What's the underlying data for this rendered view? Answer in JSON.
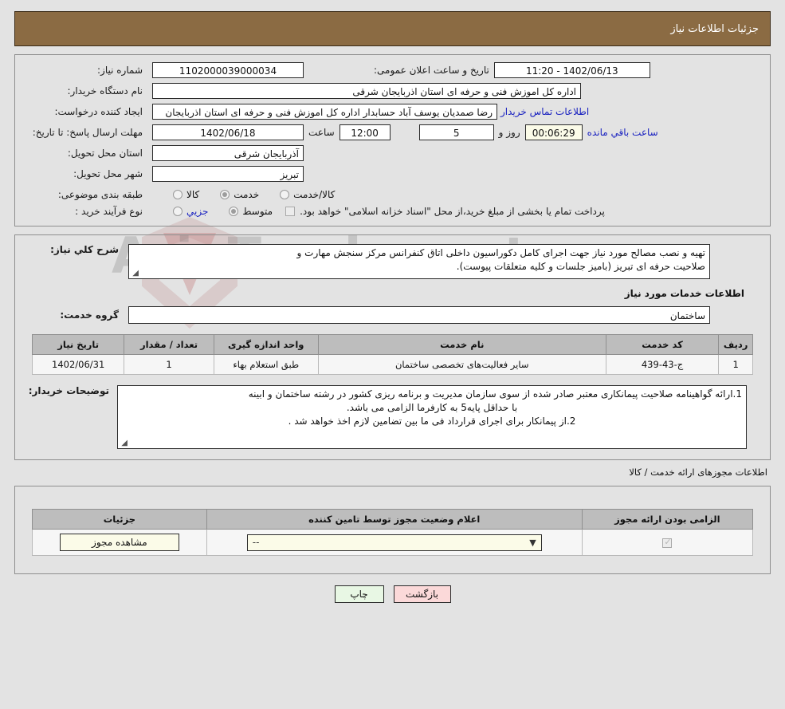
{
  "header": {
    "title": "جزئیات اطلاعات نیاز"
  },
  "form": {
    "need_number_label": "شماره نیاز:",
    "need_number_value": "1102000039000034",
    "announce_label": "تاریخ و ساعت اعلان عمومی:",
    "announce_value": "1402/06/13 - 11:20",
    "buyer_org_label": "نام دستگاه خریدار:",
    "buyer_org_value": "اداره کل اموزش فنی و حرفه ای استان اذربایجان شرقی",
    "creator_label": "ایجاد کننده درخواست:",
    "creator_value": "رضا صمدیان یوسف آباد حسابدار اداره کل اموزش فنی و حرفه ای استان اذربایجان",
    "contact_link": "اطلاعات تماس خریدار",
    "deadline_label": "مهلت ارسال پاسخ: تا تاریخ:",
    "deadline_date": "1402/06/18",
    "hour_label": "ساعت",
    "deadline_time": "12:00",
    "days_left": "5",
    "days_label": "روز و",
    "countdown": "00:06:29",
    "remaining_label": "ساعت باقي مانده",
    "province_label": "استان محل تحویل:",
    "province_value": "آذربایجان شرقی",
    "city_label": "شهر محل تحویل:",
    "city_value": "تبریز",
    "category_label": "طبقه بندی موضوعی:",
    "category_options": [
      {
        "label": "کالا",
        "selected": false
      },
      {
        "label": "خدمت",
        "selected": true
      },
      {
        "label": "کالا/خدمت",
        "selected": false
      }
    ],
    "process_label": "نوع فرآیند خرید :",
    "process_options": [
      {
        "label": "جزیي",
        "selected": false
      },
      {
        "label": "متوسط",
        "selected": true
      }
    ],
    "treasury_checkbox_checked": false,
    "treasury_note": "پرداخت تمام یا بخشی از مبلغ خرید،از محل \"اسناد خزانه اسلامی\" خواهد بود."
  },
  "description": {
    "label": "شرح كلي نياز:",
    "line1": "تهیه و نصب مصالح مورد نیاز جهت اجرای کامل دکوراسیون داخلی اتاق کنفرانس مرکز سنجش مهارت و",
    "line2": "صلاحیت حرفه ای تبریز (بامیز جلسات و کلیه متعلقات پیوست)."
  },
  "services": {
    "section_title": "اطلاعات خدمات مورد نیاز",
    "group_label": "گروه خدمت:",
    "group_value": "ساختمان",
    "columns": [
      "ردیف",
      "کد خدمت",
      "نام خدمت",
      "واحد اندازه گیری",
      "تعداد / مقدار",
      "تاریخ نیاز"
    ],
    "rows": [
      {
        "index": "1",
        "code": "ج-43-439",
        "name": "سایر فعالیت‌های تخصصی ساختمان",
        "unit": "طبق استعلام بهاء",
        "quantity": "1",
        "date": "1402/06/31"
      }
    ]
  },
  "buyer_notes": {
    "label": "توضیحات خریدار:",
    "line1": "1.ارائه گواهینامه صلاحیت پیمانکاری معتبر صادر شده از سوی سازمان مدیریت و برنامه ریزی کشور در رشته ساختمان و ابینه",
    "line2": "با حداقل پایه5 به کارفرما الزامی می باشد.",
    "line3": "2.از پیمانکار برای اجرای قرارداد فی ما بین تضامین لازم اخذ خواهد شد ."
  },
  "permits": {
    "section_label": "اطلاعات مجوزهای ارائه خدمت / کالا",
    "columns": [
      "الزامی بودن ارائه مجوز",
      "اعلام وضعیت مجوز توسط تامین کننده",
      "جزئیات"
    ],
    "rows": [
      {
        "required_checked": true,
        "status_value": "--",
        "details_button": "مشاهده مجوز"
      }
    ]
  },
  "footer": {
    "print_label": "چاپ",
    "back_label": "بازگشت"
  },
  "watermark": {
    "text": "AriaTender.net"
  }
}
